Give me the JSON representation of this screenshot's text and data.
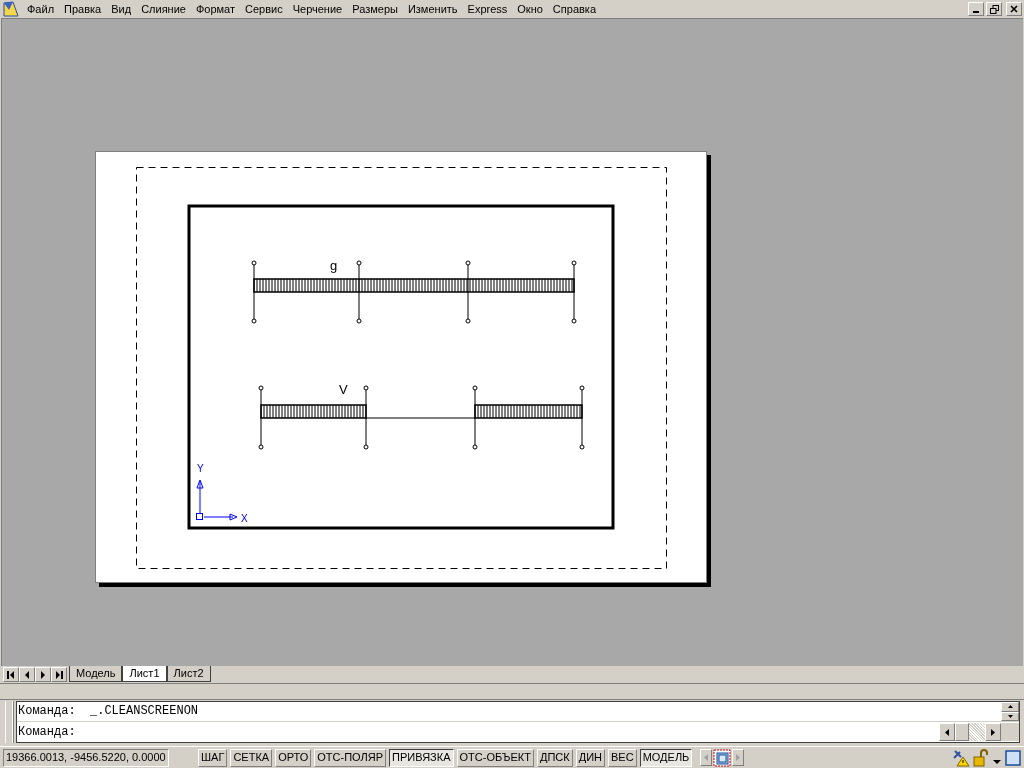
{
  "menu": [
    {
      "label": "Файл"
    },
    {
      "label": "Правка"
    },
    {
      "label": "Вид"
    },
    {
      "label": "Слияние"
    },
    {
      "label": "Формат"
    },
    {
      "label": "Сервис"
    },
    {
      "label": "Черчение"
    },
    {
      "label": "Размеры"
    },
    {
      "label": "Изменить"
    },
    {
      "label": "Express"
    },
    {
      "label": "Окно"
    },
    {
      "label": "Справка"
    }
  ],
  "drawing": {
    "beams": [
      {
        "label": "g",
        "kind": "continuous"
      },
      {
        "label": "V",
        "kind": "split"
      }
    ],
    "ucs": {
      "x_label": "X",
      "y_label": "Y"
    }
  },
  "layout_tabs": [
    {
      "label": "Модель",
      "selected": false
    },
    {
      "label": "Лист1",
      "selected": true
    },
    {
      "label": "Лист2",
      "selected": false
    }
  ],
  "command_history": [
    "Команда:  _.CLEANSCREENON"
  ],
  "command_prompt": "Команда:",
  "coordinates": "19366.0013, -9456.5220, 0.0000",
  "status_toggles": [
    {
      "label": "ШАГ",
      "on": false
    },
    {
      "label": "СЕТКА",
      "on": false
    },
    {
      "label": "ОРТО",
      "on": false
    },
    {
      "label": "ОТС-ПОЛЯР",
      "on": false
    },
    {
      "label": "ПРИВЯЗКА",
      "on": true
    },
    {
      "label": "ОТС-ОБЪЕКТ",
      "on": false
    },
    {
      "label": "ДПСК",
      "on": false
    },
    {
      "label": "ДИН",
      "on": false
    },
    {
      "label": "ВЕС",
      "on": false
    },
    {
      "label": "МОДЕЛЬ",
      "on": true
    }
  ]
}
